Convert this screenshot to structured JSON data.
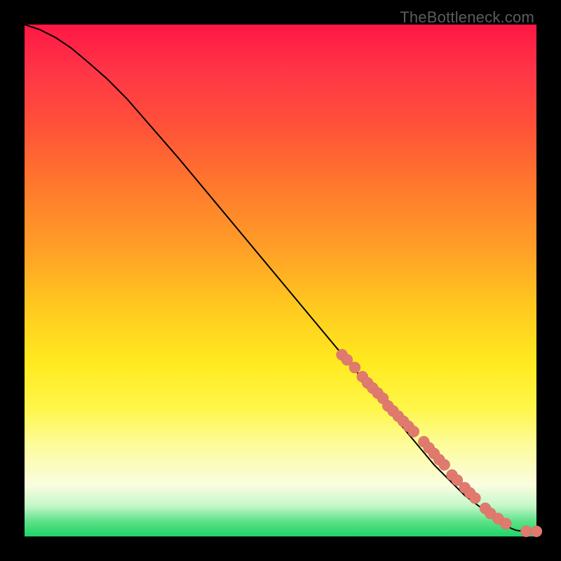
{
  "watermark": "TheBottleneck.com",
  "colors": {
    "dot_fill": "#e07a6f",
    "dot_stroke": "#d46a5f",
    "curve": "#000000",
    "page_bg": "#000000"
  },
  "chart_data": {
    "type": "line",
    "title": "",
    "xlabel": "",
    "ylabel": "",
    "xlim": [
      0,
      100
    ],
    "ylim": [
      0,
      100
    ],
    "curve": {
      "x": [
        0,
        3,
        6,
        9,
        12,
        16,
        20,
        30,
        40,
        50,
        60,
        70,
        80,
        86,
        90,
        92,
        94,
        95,
        96,
        98,
        100
      ],
      "y": [
        100,
        99,
        97.5,
        95.5,
        93,
        89.5,
        85.5,
        74,
        62,
        50,
        38,
        26,
        14,
        8,
        5,
        3.5,
        2.3,
        1.6,
        1.2,
        0.9,
        0.9
      ]
    },
    "series": [
      {
        "name": "points",
        "x": [
          62,
          63,
          64.5,
          66,
          67,
          68,
          69,
          70,
          71,
          72,
          73,
          74,
          75,
          76,
          78,
          79,
          80,
          81,
          82,
          83.5,
          84.5,
          86,
          87,
          88,
          90,
          91,
          92.5,
          94,
          98,
          100
        ],
        "y": [
          35.5,
          34.5,
          33,
          31.2,
          30,
          29,
          28,
          27,
          25.5,
          24.5,
          23.5,
          22.5,
          21.5,
          20.5,
          18.5,
          17.3,
          16.2,
          15,
          14,
          12,
          11,
          9.5,
          8.5,
          7.5,
          5.5,
          4.5,
          3.5,
          2.5,
          1.0,
          1.0
        ]
      }
    ]
  }
}
